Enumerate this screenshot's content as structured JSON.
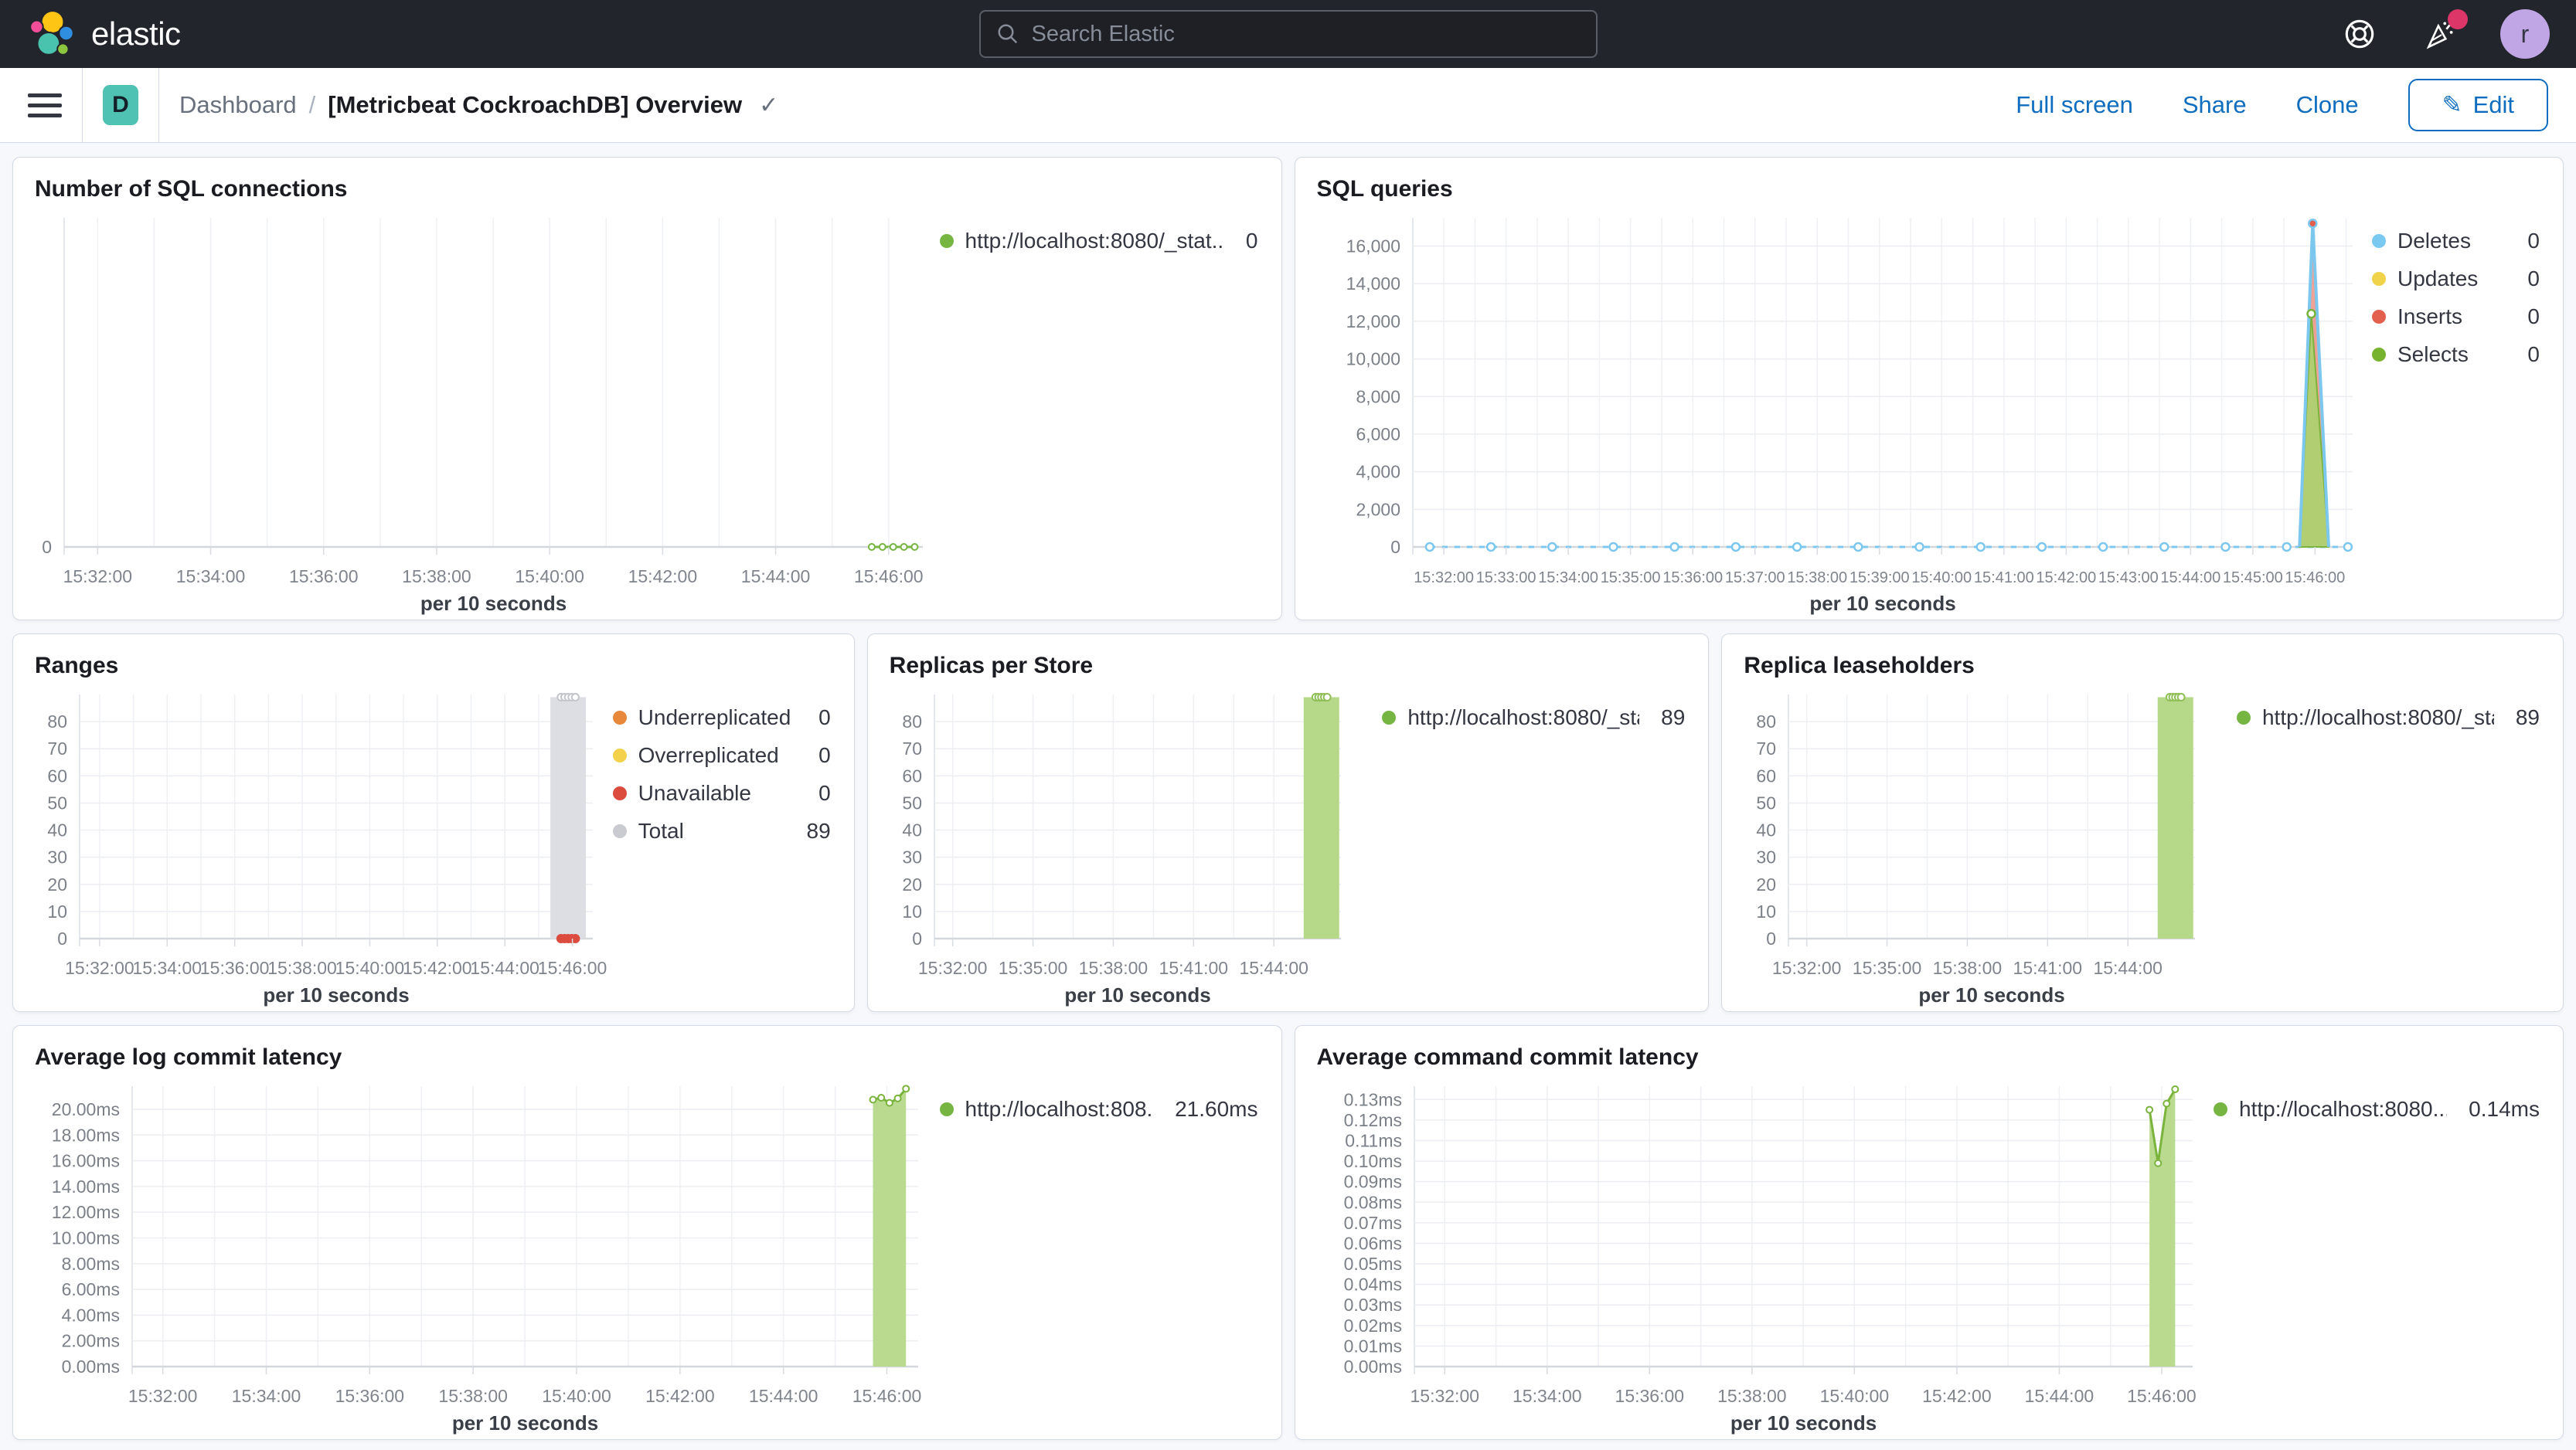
{
  "header": {
    "brand": "elastic",
    "search_placeholder": "Search Elastic",
    "avatar_initial": "r",
    "notification_color": "#DC3568"
  },
  "toolbar": {
    "badge": "D",
    "breadcrumb_root": "Dashboard",
    "breadcrumb_separator": "/",
    "title": "[Metricbeat CockroachDB] Overview",
    "title_check": "✓",
    "actions": {
      "full_screen": "Full screen",
      "share": "Share",
      "clone": "Clone",
      "edit": "Edit",
      "edit_icon": "✎"
    },
    "accent_color": "#0E6DBE"
  },
  "chart_data": [
    {
      "id": "sql-connections",
      "type": "line",
      "title": "Number of SQL connections",
      "xlabel": "per 10 seconds",
      "ylim": [
        0,
        1
      ],
      "yticks": [
        [
          0,
          "0"
        ]
      ],
      "xticks": [
        [
          0.039,
          "15:32:00"
        ],
        [
          0.1706,
          "15:34:00"
        ],
        [
          0.3022,
          "15:36:00"
        ],
        [
          0.4338,
          "15:38:00"
        ],
        [
          0.5654,
          "15:40:00"
        ],
        [
          0.697,
          "15:42:00"
        ],
        [
          0.8286,
          "15:44:00"
        ],
        [
          0.9602,
          "15:46:00"
        ]
      ],
      "marks": [
        {
          "t": "line",
          "pts": [
            [
              0.9405,
              0
            ],
            [
              0.953,
              0
            ],
            [
              0.9655,
              0
            ],
            [
              0.978,
              0
            ],
            [
              0.9905,
              0
            ]
          ],
          "stroke": "#77B543",
          "w": 3
        },
        {
          "t": "markers",
          "pts": [
            [
              0.9405,
              0
            ],
            [
              0.953,
              0
            ],
            [
              0.9655,
              0
            ],
            [
              0.978,
              0
            ],
            [
              0.9905,
              0
            ]
          ],
          "r": 4,
          "stroke": "#77B543",
          "fill": "#FFFFFF",
          "sw": 2
        }
      ],
      "legend": [
        {
          "label": "http://localhost:8080/_stat...",
          "value": "0",
          "color": "#77B543"
        }
      ]
    },
    {
      "id": "sql-queries",
      "type": "area",
      "title": "SQL queries",
      "xlabel": "per 10 seconds",
      "ylim": [
        0,
        17500
      ],
      "yticks": [
        [
          0,
          "0"
        ],
        [
          2000,
          "2,000"
        ],
        [
          4000,
          "4,000"
        ],
        [
          6000,
          "6,000"
        ],
        [
          8000,
          "8,000"
        ],
        [
          10000,
          "10,000"
        ],
        [
          12000,
          "12,000"
        ],
        [
          14000,
          "14,000"
        ],
        [
          16000,
          "16,000"
        ]
      ],
      "xticks": [
        [
          0.033,
          "15:32:00"
        ],
        [
          0.0992,
          "15:33:00"
        ],
        [
          0.1654,
          "15:34:00"
        ],
        [
          0.2316,
          "15:35:00"
        ],
        [
          0.2979,
          "15:36:00"
        ],
        [
          0.3641,
          "15:37:00"
        ],
        [
          0.4303,
          "15:38:00"
        ],
        [
          0.4965,
          "15:39:00"
        ],
        [
          0.5627,
          "15:40:00"
        ],
        [
          0.629,
          "15:41:00"
        ],
        [
          0.6952,
          "15:42:00"
        ],
        [
          0.7614,
          "15:43:00"
        ],
        [
          0.8276,
          "15:44:00"
        ],
        [
          0.8938,
          "15:45:00"
        ],
        [
          0.96,
          "15:46:00"
        ]
      ],
      "marks": [
        {
          "t": "markerline",
          "y": 0,
          "x0": 0.018,
          "x1": 0.995,
          "n": 16,
          "r": 5,
          "stroke": "#7CC7EE",
          "fill": "#FFFFFF",
          "sw": 2.5,
          "gap": [
            0.9405,
            0.978
          ]
        },
        {
          "t": "area",
          "pts": [
            [
              0.9435,
              0
            ],
            [
              0.9575,
              16700
            ],
            [
              0.9745,
              0
            ]
          ],
          "fill": "rgba(229,106,87,0.62)",
          "stroke": "#E4604E",
          "sw": 2
        },
        {
          "t": "area",
          "pts": [
            [
              0.9435,
              0
            ],
            [
              0.956,
              12400
            ],
            [
              0.9745,
              0
            ]
          ],
          "fill": "rgba(171,209,111,0.92)",
          "stroke": "#7AB43C",
          "sw": 2
        },
        {
          "t": "line",
          "pts": [
            [
              0.9435,
              0
            ],
            [
              0.9575,
              17200
            ],
            [
              0.9745,
              0
            ]
          ],
          "stroke": "#7CC7EE",
          "w": 4
        },
        {
          "t": "markers",
          "pts": [
            [
              0.9575,
              17200
            ]
          ],
          "r": 5,
          "stroke": "#7CC7EE",
          "fill": "#E4604E",
          "sw": 2.5
        },
        {
          "t": "markers",
          "pts": [
            [
              0.956,
              12400
            ]
          ],
          "r": 5,
          "stroke": "#7AB43C",
          "fill": "#FFFFFF",
          "sw": 2.5
        }
      ],
      "legend": [
        {
          "label": "Deletes",
          "value": "0",
          "color": "#79C9F1"
        },
        {
          "label": "Updates",
          "value": "0",
          "color": "#F1D24B"
        },
        {
          "label": "Inserts",
          "value": "0",
          "color": "#E4604E"
        },
        {
          "label": "Selects",
          "value": "0",
          "color": "#77B32E"
        }
      ]
    },
    {
      "id": "ranges",
      "type": "bar",
      "title": "Ranges",
      "xlabel": "per 10 seconds",
      "ylim": [
        0,
        90
      ],
      "yticks": [
        [
          0,
          "0"
        ],
        [
          10,
          "10"
        ],
        [
          20,
          "20"
        ],
        [
          30,
          "30"
        ],
        [
          40,
          "40"
        ],
        [
          50,
          "50"
        ],
        [
          60,
          "60"
        ],
        [
          70,
          "70"
        ],
        [
          80,
          "80"
        ]
      ],
      "xticks": [
        [
          0.039,
          "15:32:00"
        ],
        [
          0.1706,
          "15:34:00"
        ],
        [
          0.3022,
          "15:36:00"
        ],
        [
          0.4338,
          "15:38:00"
        ],
        [
          0.5654,
          "15:40:00"
        ],
        [
          0.697,
          "15:42:00"
        ],
        [
          0.8286,
          "15:44:00"
        ],
        [
          0.9602,
          "15:46:00"
        ]
      ],
      "marks": [
        {
          "t": "bar",
          "x": 0.952,
          "wpx": 46,
          "v": 89,
          "fill": "#DCDEE3"
        },
        {
          "t": "markers",
          "pts": [
            [
              0.938,
              89
            ],
            [
              0.945,
              89
            ],
            [
              0.952,
              89
            ],
            [
              0.959,
              89
            ],
            [
              0.966,
              89
            ]
          ],
          "r": 4.5,
          "stroke": "#C2C5CB",
          "fill": "#FFFFFF",
          "sw": 2
        },
        {
          "t": "markers",
          "pts": [
            [
              0.938,
              0
            ],
            [
              0.945,
              0
            ],
            [
              0.952,
              0
            ],
            [
              0.959,
              0
            ],
            [
              0.966,
              0
            ]
          ],
          "r": 5.5,
          "stroke": "#DB4C3F",
          "fill": "#DB4C3F",
          "sw": 1
        }
      ],
      "legend": [
        {
          "label": "Underreplicated",
          "value": "0",
          "color": "#E8883A"
        },
        {
          "label": "Overreplicated",
          "value": "0",
          "color": "#F3D14B"
        },
        {
          "label": "Unavailable",
          "value": "0",
          "color": "#DB4C3F"
        },
        {
          "label": "Total",
          "value": "89",
          "color": "#C9CBD0"
        }
      ]
    },
    {
      "id": "replicas-per-store",
      "type": "bar",
      "title": "Replicas per Store",
      "xlabel": "per 10 seconds",
      "ylim": [
        0,
        90
      ],
      "yticks": [
        [
          0,
          "0"
        ],
        [
          10,
          "10"
        ],
        [
          20,
          "20"
        ],
        [
          30,
          "30"
        ],
        [
          40,
          "40"
        ],
        [
          50,
          "50"
        ],
        [
          60,
          "60"
        ],
        [
          70,
          "70"
        ],
        [
          80,
          "80"
        ]
      ],
      "xticks": [
        [
          0.045,
          "15:32:00"
        ],
        [
          0.2425,
          "15:35:00"
        ],
        [
          0.44,
          "15:38:00"
        ],
        [
          0.6375,
          "15:41:00"
        ],
        [
          0.835,
          "15:44:00"
        ]
      ],
      "marks": [
        {
          "t": "bar",
          "x": 0.952,
          "wpx": 46,
          "v": 89,
          "fill": "#B6D889"
        },
        {
          "t": "markers",
          "pts": [
            [
              0.938,
              89
            ],
            [
              0.945,
              89
            ],
            [
              0.952,
              89
            ],
            [
              0.959,
              89
            ],
            [
              0.966,
              89
            ]
          ],
          "r": 4.5,
          "stroke": "#8FBE56",
          "fill": "#FFFFFF",
          "sw": 2
        }
      ],
      "legend": [
        {
          "label": "http://localhost:8080/_sta...",
          "value": "89",
          "color": "#77B543"
        }
      ]
    },
    {
      "id": "replica-leaseholders",
      "type": "bar",
      "title": "Replica leaseholders",
      "xlabel": "per 10 seconds",
      "ylim": [
        0,
        90
      ],
      "yticks": [
        [
          0,
          "0"
        ],
        [
          10,
          "10"
        ],
        [
          20,
          "20"
        ],
        [
          30,
          "30"
        ],
        [
          40,
          "40"
        ],
        [
          50,
          "50"
        ],
        [
          60,
          "60"
        ],
        [
          70,
          "70"
        ],
        [
          80,
          "80"
        ]
      ],
      "xticks": [
        [
          0.045,
          "15:32:00"
        ],
        [
          0.2425,
          "15:35:00"
        ],
        [
          0.44,
          "15:38:00"
        ],
        [
          0.6375,
          "15:41:00"
        ],
        [
          0.835,
          "15:44:00"
        ]
      ],
      "marks": [
        {
          "t": "bar",
          "x": 0.952,
          "wpx": 46,
          "v": 89,
          "fill": "#B6D889"
        },
        {
          "t": "markers",
          "pts": [
            [
              0.938,
              89
            ],
            [
              0.945,
              89
            ],
            [
              0.952,
              89
            ],
            [
              0.959,
              89
            ],
            [
              0.966,
              89
            ]
          ],
          "r": 4.5,
          "stroke": "#8FBE56",
          "fill": "#FFFFFF",
          "sw": 2
        }
      ],
      "legend": [
        {
          "label": "http://localhost:8080/_sta...",
          "value": "89",
          "color": "#77B543"
        }
      ]
    },
    {
      "id": "avg-log-commit-latency",
      "type": "area",
      "title": "Average log commit latency",
      "xlabel": "per 10 seconds",
      "ylim": [
        0,
        21.8
      ],
      "yticks": [
        [
          0,
          "0.00ms"
        ],
        [
          2,
          "2.00ms"
        ],
        [
          4,
          "4.00ms"
        ],
        [
          6,
          "6.00ms"
        ],
        [
          8,
          "8.00ms"
        ],
        [
          10,
          "10.00ms"
        ],
        [
          12,
          "12.00ms"
        ],
        [
          14,
          "14.00ms"
        ],
        [
          16,
          "16.00ms"
        ],
        [
          18,
          "18.00ms"
        ],
        [
          20,
          "20.00ms"
        ]
      ],
      "xticks": [
        [
          0.039,
          "15:32:00"
        ],
        [
          0.1706,
          "15:34:00"
        ],
        [
          0.3022,
          "15:36:00"
        ],
        [
          0.4338,
          "15:38:00"
        ],
        [
          0.5654,
          "15:40:00"
        ],
        [
          0.697,
          "15:42:00"
        ],
        [
          0.8286,
          "15:44:00"
        ],
        [
          0.9602,
          "15:46:00"
        ]
      ],
      "marks": [
        {
          "t": "area",
          "pts": [
            [
              0.9425,
              20.75
            ],
            [
              0.953,
              20.9
            ],
            [
              0.9635,
              20.5
            ],
            [
              0.974,
              20.85
            ],
            [
              0.9845,
              21.6
            ]
          ],
          "base": 0,
          "fill": "rgba(182,216,137,0.95)",
          "stroke": "none",
          "sw": 0
        },
        {
          "t": "line",
          "pts": [
            [
              0.9425,
              20.75
            ],
            [
              0.953,
              20.9
            ],
            [
              0.9635,
              20.5
            ],
            [
              0.974,
              20.85
            ],
            [
              0.9845,
              21.6
            ]
          ],
          "stroke": "#7AB43C",
          "w": 3
        },
        {
          "t": "markers",
          "pts": [
            [
              0.9425,
              20.75
            ],
            [
              0.953,
              20.9
            ],
            [
              0.9635,
              20.5
            ],
            [
              0.974,
              20.85
            ],
            [
              0.9845,
              21.6
            ]
          ],
          "r": 4,
          "stroke": "#7AB43C",
          "fill": "#FFFFFF",
          "sw": 2
        }
      ],
      "legend": [
        {
          "label": "http://localhost:808...",
          "value": "21.60ms",
          "color": "#77B543"
        }
      ]
    },
    {
      "id": "avg-command-commit-latency",
      "type": "area",
      "title": "Average command commit latency",
      "xlabel": "per 10 seconds",
      "ylim": [
        0,
        0.1365
      ],
      "yticks": [
        [
          0,
          "0.00ms"
        ],
        [
          0.01,
          "0.01ms"
        ],
        [
          0.02,
          "0.02ms"
        ],
        [
          0.03,
          "0.03ms"
        ],
        [
          0.04,
          "0.04ms"
        ],
        [
          0.05,
          "0.05ms"
        ],
        [
          0.06,
          "0.06ms"
        ],
        [
          0.07,
          "0.07ms"
        ],
        [
          0.08,
          "0.08ms"
        ],
        [
          0.09,
          "0.09ms"
        ],
        [
          0.1,
          "0.10ms"
        ],
        [
          0.11,
          "0.11ms"
        ],
        [
          0.12,
          "0.12ms"
        ],
        [
          0.13,
          "0.13ms"
        ]
      ],
      "xticks": [
        [
          0.039,
          "15:32:00"
        ],
        [
          0.1706,
          "15:34:00"
        ],
        [
          0.3022,
          "15:36:00"
        ],
        [
          0.4338,
          "15:38:00"
        ],
        [
          0.5654,
          "15:40:00"
        ],
        [
          0.697,
          "15:42:00"
        ],
        [
          0.8286,
          "15:44:00"
        ],
        [
          0.9602,
          "15:46:00"
        ]
      ],
      "marks": [
        {
          "t": "area",
          "pts": [
            [
              0.9445,
              0.125
            ],
            [
              0.9555,
              0.099
            ],
            [
              0.9665,
              0.128
            ],
            [
              0.9775,
              0.135
            ]
          ],
          "base": 0,
          "fill": "rgba(182,216,137,0.95)",
          "stroke": "none",
          "sw": 0
        },
        {
          "t": "line",
          "pts": [
            [
              0.9445,
              0.125
            ],
            [
              0.9555,
              0.099
            ],
            [
              0.9665,
              0.128
            ],
            [
              0.9775,
              0.135
            ]
          ],
          "stroke": "#7AB43C",
          "w": 3
        },
        {
          "t": "markers",
          "pts": [
            [
              0.9445,
              0.125
            ],
            [
              0.9555,
              0.099
            ],
            [
              0.9665,
              0.128
            ],
            [
              0.9775,
              0.135
            ]
          ],
          "r": 4,
          "stroke": "#7AB43C",
          "fill": "#FFFFFF",
          "sw": 2
        }
      ],
      "legend": [
        {
          "label": "http://localhost:8080...",
          "value": "0.14ms",
          "color": "#77B543"
        }
      ]
    }
  ]
}
